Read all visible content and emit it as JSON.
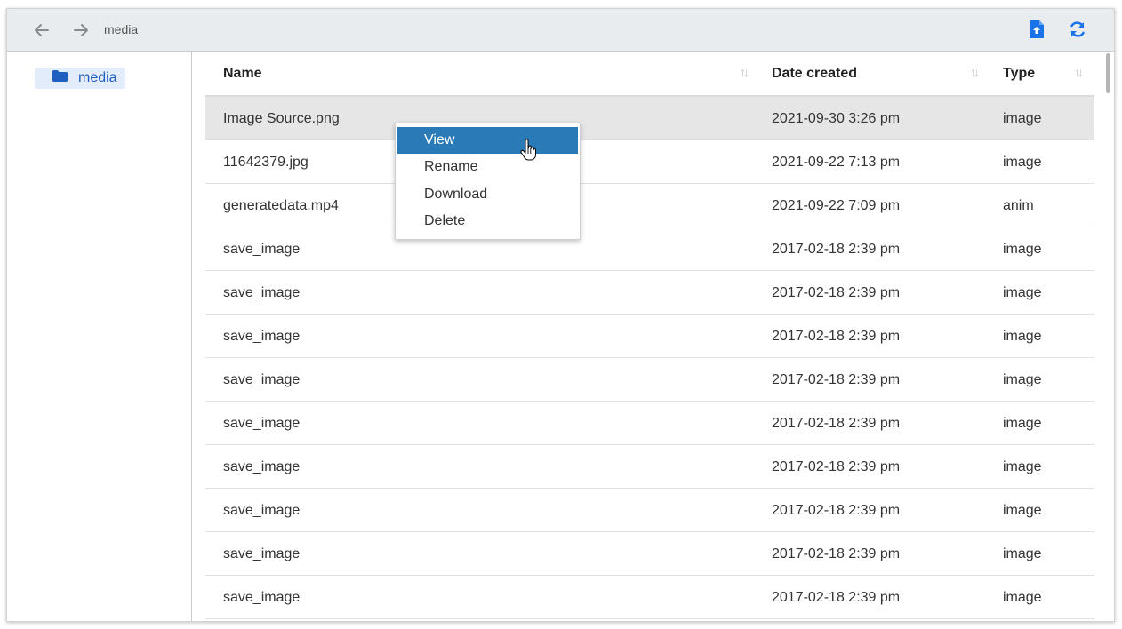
{
  "toolbar": {
    "back_icon": "arrow-left-icon",
    "forward_icon": "arrow-right-icon",
    "breadcrumb": "media",
    "upload_icon": "file-upload-icon",
    "refresh_icon": "refresh-icon",
    "accent_color": "#1a73e8"
  },
  "sidebar": {
    "items": [
      {
        "label": "media",
        "icon": "folder-icon"
      }
    ]
  },
  "table": {
    "columns": [
      {
        "label": "Name"
      },
      {
        "label": "Date created"
      },
      {
        "label": "Type"
      }
    ],
    "rows": [
      {
        "name": "Image Source.png",
        "date": "2021-09-30 3:26 pm",
        "type": "image",
        "selected": true
      },
      {
        "name": "11642379.jpg",
        "date": "2021-09-22 7:13 pm",
        "type": "image"
      },
      {
        "name": "generatedata.mp4",
        "date": "2021-09-22 7:09 pm",
        "type": "anim"
      },
      {
        "name": "save_image",
        "date": "2017-02-18 2:39 pm",
        "type": "image"
      },
      {
        "name": "save_image",
        "date": "2017-02-18 2:39 pm",
        "type": "image"
      },
      {
        "name": "save_image",
        "date": "2017-02-18 2:39 pm",
        "type": "image"
      },
      {
        "name": "save_image",
        "date": "2017-02-18 2:39 pm",
        "type": "image"
      },
      {
        "name": "save_image",
        "date": "2017-02-18 2:39 pm",
        "type": "image"
      },
      {
        "name": "save_image",
        "date": "2017-02-18 2:39 pm",
        "type": "image"
      },
      {
        "name": "save_image",
        "date": "2017-02-18 2:39 pm",
        "type": "image"
      },
      {
        "name": "save_image",
        "date": "2017-02-18 2:39 pm",
        "type": "image"
      },
      {
        "name": "save_image",
        "date": "2017-02-18 2:39 pm",
        "type": "image"
      }
    ]
  },
  "context_menu": {
    "items": [
      {
        "label": "View",
        "active": true
      },
      {
        "label": "Rename"
      },
      {
        "label": "Download"
      },
      {
        "label": "Delete"
      }
    ],
    "highlight_color": "#2a7ab8"
  }
}
